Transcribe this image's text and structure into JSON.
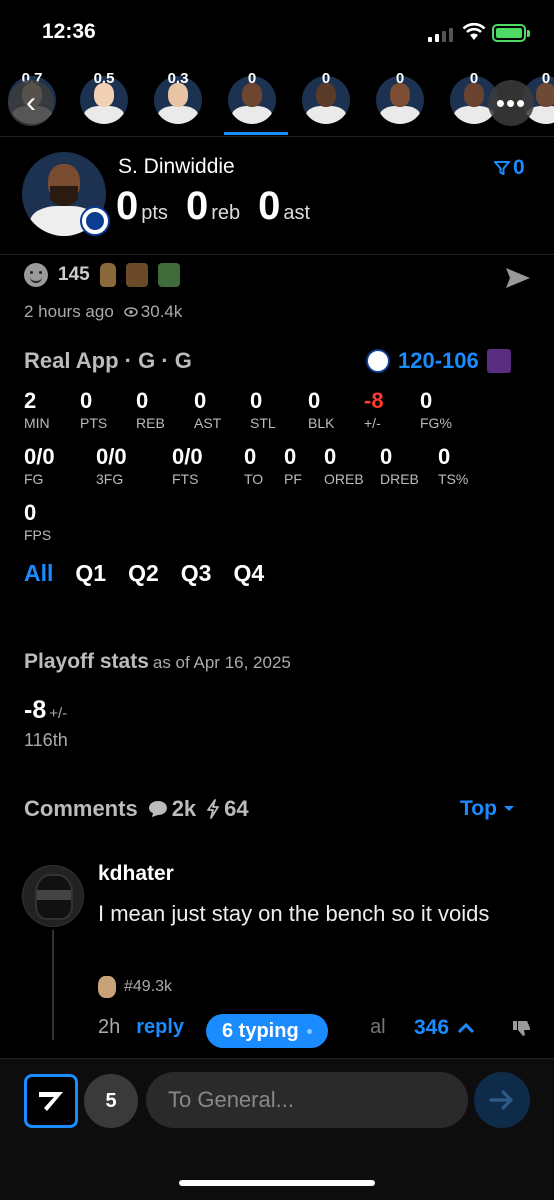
{
  "status": {
    "time": "12:36"
  },
  "strip": {
    "players": [
      {
        "value": "0.7",
        "skin": "#f0c8a8"
      },
      {
        "value": "0.5",
        "skin": "#f2d0b4"
      },
      {
        "value": "0.3",
        "skin": "#e8c4a4"
      },
      {
        "value": "0",
        "skin": "#6e4630"
      },
      {
        "value": "0",
        "skin": "#5a3a28"
      },
      {
        "value": "0",
        "skin": "#7b4e34"
      },
      {
        "value": "0",
        "skin": "#6a4230"
      },
      {
        "value": "0",
        "skin": "#6e4a34"
      }
    ]
  },
  "player": {
    "name": "S. Dinwiddie",
    "filter_count": "0",
    "pts": "0",
    "pts_label": "pts",
    "reb": "0",
    "reb_label": "reb",
    "ast": "0",
    "ast_label": "ast"
  },
  "post": {
    "reaction_count": "145",
    "time_ago": "2 hours ago",
    "views": "30.4k"
  },
  "game": {
    "title": "Real App · G · G",
    "home_score": "120",
    "away_score": "106",
    "stats": [
      {
        "v": "2",
        "l": "MIN"
      },
      {
        "v": "0",
        "l": "PTS"
      },
      {
        "v": "0",
        "l": "REB"
      },
      {
        "v": "0",
        "l": "AST"
      },
      {
        "v": "0",
        "l": "STL"
      },
      {
        "v": "0",
        "l": "BLK"
      },
      {
        "v": "-8",
        "l": "+/-",
        "neg": true
      },
      {
        "v": "0",
        "l": "FG%"
      },
      {
        "v": "0/0",
        "l": "FG"
      },
      {
        "v": "0/0",
        "l": "3FG"
      },
      {
        "v": "0/0",
        "l": "FTS"
      },
      {
        "v": "0",
        "l": "TO"
      },
      {
        "v": "0",
        "l": "PF"
      },
      {
        "v": "0",
        "l": "OREB"
      },
      {
        "v": "0",
        "l": "DREB"
      },
      {
        "v": "0",
        "l": "TS%"
      },
      {
        "v": "0",
        "l": "FPS"
      }
    ],
    "periods": [
      "All",
      "Q1",
      "Q2",
      "Q3",
      "Q4"
    ]
  },
  "playoff": {
    "title": "Playoff stats",
    "as_of": "as of Apr 16, 2025",
    "value": "-8",
    "unit": "+/-",
    "rank": "116th"
  },
  "comments": {
    "title": "Comments",
    "count": "2k",
    "bolts": "64",
    "sort": "Top",
    "items": [
      {
        "user": "kdhater",
        "text": "I mean just stay on the bench so it voids",
        "badge": "#49.3k",
        "time": "2h",
        "reply": "reply",
        "trail": "al",
        "upvotes": "346"
      }
    ],
    "typing": "6 typing"
  },
  "chat": {
    "unread": "5",
    "placeholder": "To General..."
  },
  "colors": {
    "accent": "#1a8cff",
    "negative": "#ff3b30"
  }
}
